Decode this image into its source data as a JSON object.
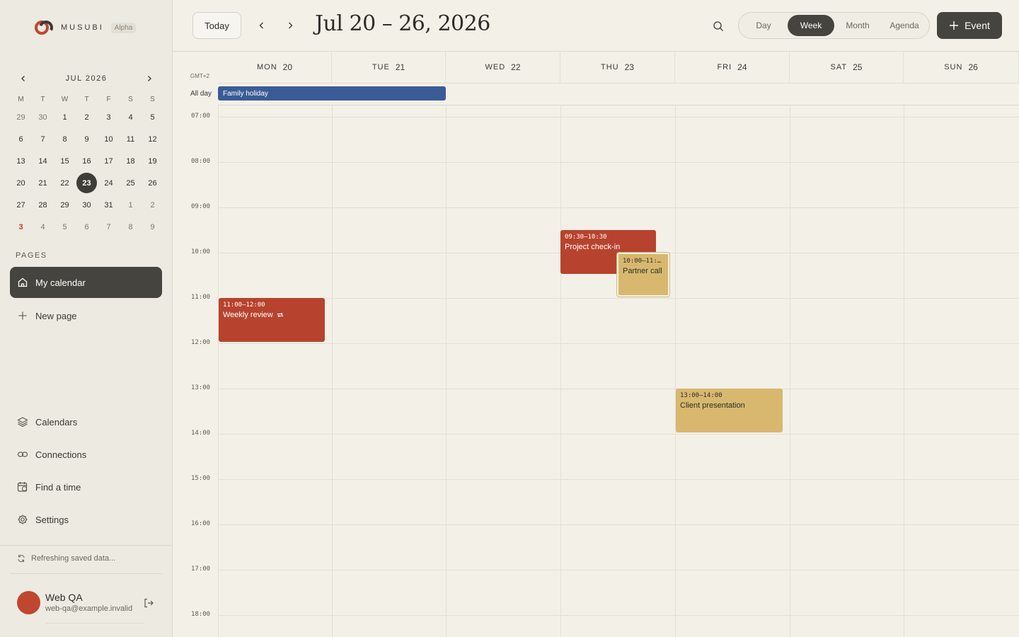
{
  "brand": {
    "name": "MUSUBI",
    "badge": "Alpha"
  },
  "mini_calendar": {
    "month_label": "JUL 2026",
    "weekdays": [
      "M",
      "T",
      "W",
      "T",
      "F",
      "S",
      "S"
    ],
    "days": [
      "29",
      "30",
      "1",
      "2",
      "3",
      "4",
      "5",
      "6",
      "7",
      "8",
      "9",
      "10",
      "11",
      "12",
      "13",
      "14",
      "15",
      "16",
      "17",
      "18",
      "19",
      "20",
      "21",
      "22",
      "23",
      "24",
      "25",
      "26",
      "27",
      "28",
      "29",
      "30",
      "31",
      "1",
      "2",
      "3",
      "4",
      "5",
      "6",
      "7",
      "8",
      "9"
    ]
  },
  "sidebar": {
    "pages_title": "PAGES",
    "pages": [
      {
        "label": "My calendar",
        "icon": "home-icon"
      },
      {
        "label": "New page",
        "icon": "plus-icon"
      }
    ],
    "bottom_items": [
      {
        "label": "Calendars",
        "icon": "layers-icon"
      },
      {
        "label": "Connections",
        "icon": "link-icon"
      },
      {
        "label": "Find a time",
        "icon": "calendar-clock-icon"
      },
      {
        "label": "Settings",
        "icon": "gear-icon"
      }
    ],
    "status": "Refreshing saved data...",
    "user": {
      "name": "Web QA",
      "email": "web-qa@example.invalid"
    }
  },
  "toolbar": {
    "today_label": "Today",
    "range_title": "Jul 20 – 26, 2026",
    "views": [
      "Day",
      "Week",
      "Month",
      "Agenda"
    ],
    "active_view": "Week",
    "event_button": "Event"
  },
  "week": {
    "timezone": "GMT+2",
    "allday_label": "All day",
    "days": [
      {
        "dow": "MON",
        "num": "20"
      },
      {
        "dow": "TUE",
        "num": "21"
      },
      {
        "dow": "WED",
        "num": "22"
      },
      {
        "dow": "THU",
        "num": "23"
      },
      {
        "dow": "FRI",
        "num": "24"
      },
      {
        "dow": "SAT",
        "num": "25"
      },
      {
        "dow": "SUN",
        "num": "26"
      }
    ],
    "hours": [
      "07:00",
      "08:00",
      "09:00",
      "10:00",
      "11:00",
      "12:00",
      "13:00",
      "14:00",
      "15:00",
      "16:00",
      "17:00",
      "18:00"
    ],
    "allday_events": [
      {
        "title": "Family holiday",
        "start_day": "MON",
        "end_day": "TUE",
        "color": "#3b5b96"
      }
    ],
    "events": [
      {
        "time": "11:00–12:00",
        "title": "Weekly review",
        "day": "MON",
        "repeat": true,
        "color": "#b7432e"
      },
      {
        "time": "09:30–10:30",
        "title": "Project check-in",
        "day": "THU",
        "color": "#b7432e"
      },
      {
        "time": "10:00–11:…",
        "title": "Partner call",
        "day": "THU",
        "color": "#d8b86e"
      },
      {
        "time": "13:00–14:00",
        "title": "Client presentation",
        "day": "FRI",
        "color": "#d8b86e"
      }
    ]
  },
  "colors": {
    "accent_dark": "#46443f",
    "red_event": "#b7432e",
    "yellow_event": "#d8b86e",
    "blue_allday": "#3b5b96",
    "today_marker": "#c03d2a"
  }
}
